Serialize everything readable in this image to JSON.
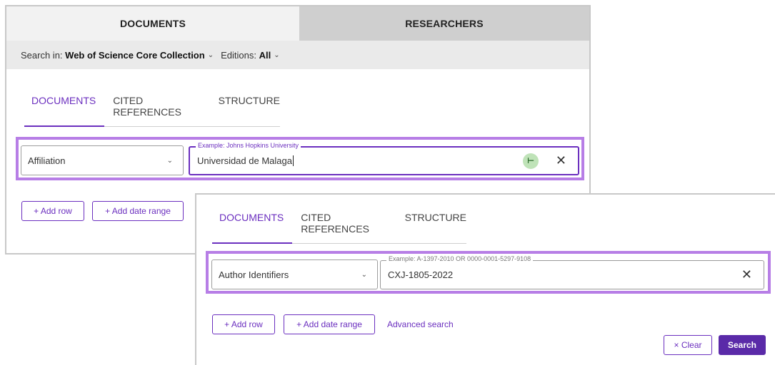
{
  "panel1": {
    "top_tabs": [
      "DOCUMENTS",
      "RESEARCHERS"
    ],
    "search_in": {
      "label": "Search in:",
      "collection": "Web of Science Core Collection",
      "editions_label": "Editions:",
      "editions_value": "All"
    },
    "sub_tabs": [
      "DOCUMENTS",
      "CITED REFERENCES",
      "STRUCTURE"
    ],
    "field": {
      "select": "Affiliation",
      "example": "Example: Johns Hopkins University",
      "value": "Universidad de Malaga"
    },
    "buttons": {
      "add_row": "+ Add row",
      "add_date_range": "+ Add date range"
    }
  },
  "panel2": {
    "sub_tabs": [
      "DOCUMENTS",
      "CITED REFERENCES",
      "STRUCTURE"
    ],
    "field": {
      "select": "Author Identifiers",
      "example": "Example: A-1397-2010 OR 0000-0001-5297-9108",
      "value": "CXJ-1805-2022"
    },
    "buttons": {
      "add_row": "+ Add row",
      "add_date_range": "+ Add date range",
      "advanced": "Advanced search",
      "clear": "× Clear",
      "search": "Search"
    }
  },
  "icons": {
    "chevron": "chevron-down-icon",
    "close": "close-icon",
    "tree": "tree-icon"
  },
  "colors": {
    "accent": "#6b2fbf",
    "highlight": "#b77ee6"
  }
}
